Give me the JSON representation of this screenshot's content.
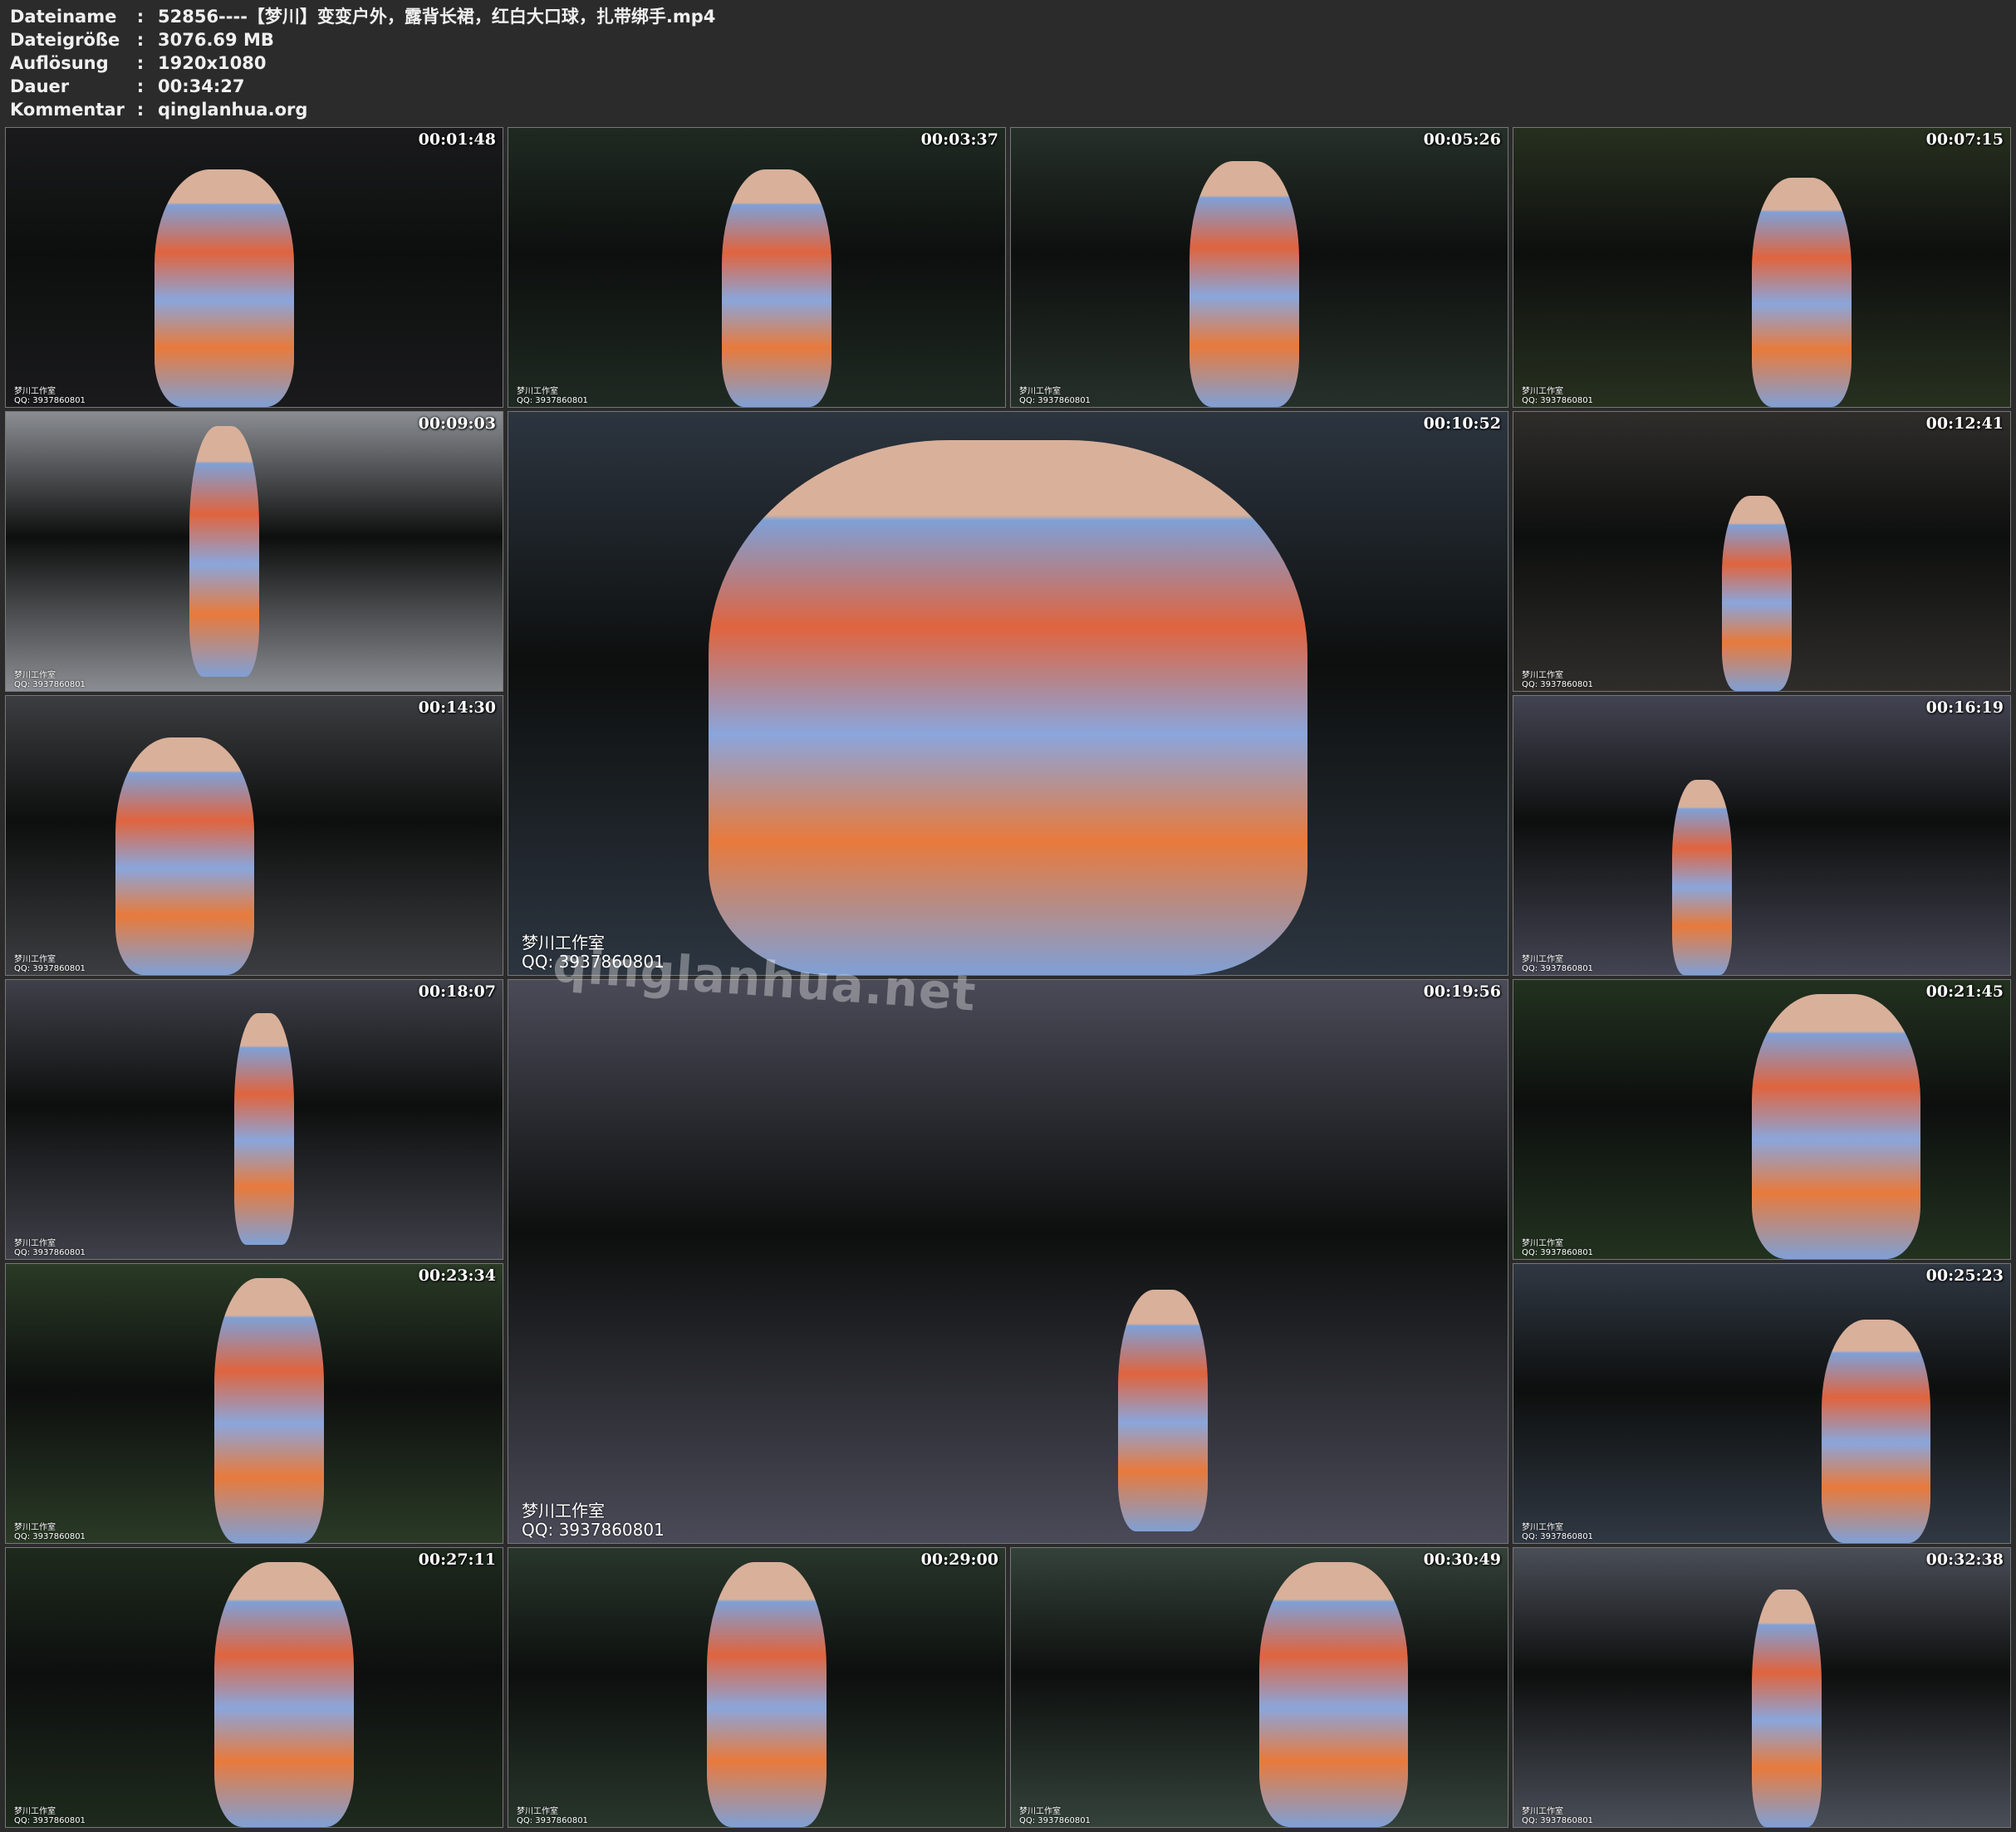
{
  "header": {
    "rows": [
      {
        "key": "Dateiname",
        "value": "52856----【梦川】变变户外，露背长裙，红白大口球，扎带绑手.mp4"
      },
      {
        "key": "Dateigröße",
        "value": "3076.69 MB"
      },
      {
        "key": "Auflösung",
        "value": "1920x1080"
      },
      {
        "key": "Dauer",
        "value": "00:34:27"
      },
      {
        "key": "Kommentar",
        "value": "qinglanhua.org"
      }
    ]
  },
  "watermark": {
    "studio": "梦川工作室",
    "qq": "QQ: 3937860801",
    "site": "qinglanhua.net"
  },
  "thumbnails": [
    {
      "time": "00:01:48",
      "scene": "#1a1a1c"
    },
    {
      "time": "00:03:37",
      "scene": "#1f2a22"
    },
    {
      "time": "00:05:26",
      "scene": "#26302a"
    },
    {
      "time": "00:07:15",
      "scene": "#27301f"
    },
    {
      "time": "00:09:03",
      "scene": "#8a8d92"
    },
    {
      "time": "00:10:52",
      "scene": "#2c3540"
    },
    {
      "time": "00:12:41",
      "scene": "#2f2d2a"
    },
    {
      "time": "00:14:30",
      "scene": "#3b3d40"
    },
    {
      "time": "00:16:19",
      "scene": "#434452"
    },
    {
      "time": "00:18:07",
      "scene": "#3f4049"
    },
    {
      "time": "00:19:56",
      "scene": "#4b4a58"
    },
    {
      "time": "00:21:45",
      "scene": "#22321f"
    },
    {
      "time": "00:23:34",
      "scene": "#2a3a26"
    },
    {
      "time": "00:25:23",
      "scene": "#303843"
    },
    {
      "time": "00:27:11",
      "scene": "#1e2a1d"
    },
    {
      "time": "00:29:00",
      "scene": "#28362b"
    },
    {
      "time": "00:30:49",
      "scene": "#34423a"
    },
    {
      "time": "00:32:38",
      "scene": "#4a4e57"
    }
  ]
}
